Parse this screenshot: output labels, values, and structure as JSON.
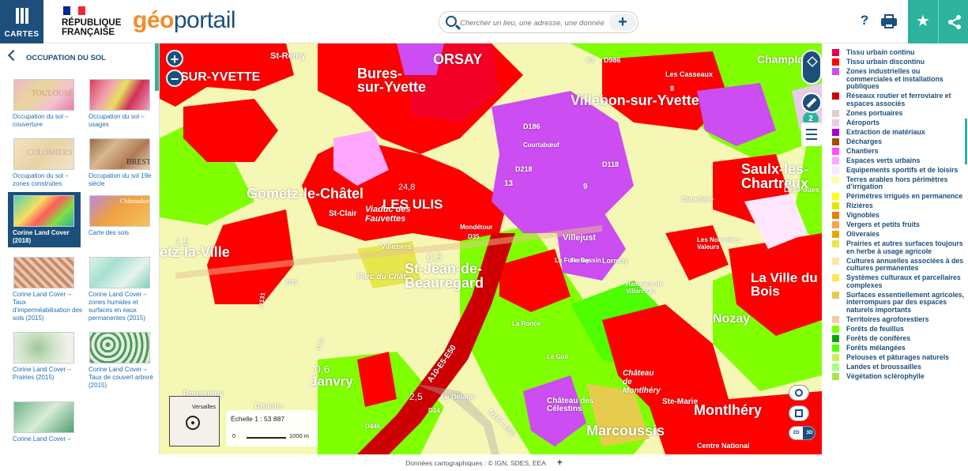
{
  "header": {
    "menu_label": "CARTES",
    "rf_text": "RÉPUBLIQUE\nFRANÇAISE",
    "logo_accent": "géo",
    "logo_rest": "portail",
    "search_placeholder": "Chercher un lieu, une adresse, une donnée",
    "search_plus": "+",
    "help_label": "?",
    "fav_icon": "★"
  },
  "sidebar": {
    "title": "OCCUPATION DU SOL",
    "thumbnails": [
      {
        "caption": "Occupation du sol – couverture",
        "img_text": "TOULOUSE"
      },
      {
        "caption": "Occupation du sol – usages",
        "img_text": ""
      },
      {
        "caption": "Occupation du sol – zones construites",
        "img_text": "COLOMIERS"
      },
      {
        "caption": "Occupation du sol 19e siècle",
        "img_text": "BREST"
      },
      {
        "caption": "Corine Land Cover (2018)",
        "img_text": ""
      },
      {
        "caption": "Carte des sols",
        "img_text": "Châteaulaou"
      },
      {
        "caption": "Corine Land Cover – Taux d’imperméabilisation des sols (2015)",
        "img_text": ""
      },
      {
        "caption": "Corine Land Cover – zones humides et surfaces en eaux permanentes (2015)",
        "img_text": ""
      },
      {
        "caption": "Corine Land Cover – Prairies (2015)",
        "img_text": ""
      },
      {
        "caption": "Corine Land Cover – Taux de couvert arboré (2015)",
        "img_text": ""
      },
      {
        "caption": "Corine Land Cover –",
        "img_text": ""
      }
    ],
    "selected_index": 4
  },
  "map": {
    "zoom_in": "+",
    "zoom_out": "−",
    "layers_count": "2",
    "btn_2d": "2D",
    "btn_3d": "3D",
    "overview_label": "Versailles",
    "scale_text": "Échelle 1 : 53 887",
    "scale_zero": "0",
    "scale_dist": "1000 m",
    "place_labels": [
      "St-Rémy",
      "Bures-sur-Yvette",
      "ORSAY",
      "Villebon-sur-Yvette",
      "Champlan",
      "Les Casseaux",
      "E-SUR-YVETTE",
      "Gometz-le-Châtel",
      "LES ULIS",
      "Saulx-les-Chartreux",
      "Mondétour",
      "St-Clair",
      "Viaduc des Fauvettes",
      "etz-la-Ville",
      "St-Jean-de-Beauregard",
      "Villejust",
      "Parc du Chât.",
      "Nozay",
      "La Ville du Bois",
      "Janvry",
      "Marcoussis",
      "Montlhéry",
      "Château de Montlhéry",
      "Ste-Marie",
      "Le Délage",
      "Roussigny",
      "Chante-",
      "Cimetière",
      "Les Nouvelles Valeurs",
      "Lormoy",
      "Fretay",
      "Hameaux de Villarceau",
      "A10-E5-E50",
      "N104-E50",
      "La Ronce",
      "Le Gué",
      "Château des Célestins",
      "Centre National",
      "Villeziers",
      "Courtabœuf",
      "La Folie Bessin",
      "Les Poues"
    ],
    "map_numbers": [
      "0,5",
      "1,5",
      "0,6",
      "2,5",
      "24,8",
      "13",
      "9",
      "63",
      "D986",
      "D218",
      "D186",
      "D118",
      "D35",
      "D35",
      "D40",
      "D131",
      "D24",
      "D446",
      "8"
    ]
  },
  "legend": {
    "items": [
      {
        "label": "Tissu urbain continu",
        "color": "#e6004d"
      },
      {
        "label": "Tissu urbain discontinu",
        "color": "#ff0000"
      },
      {
        "label": "Zones industrielles ou commerciales et installations publiques",
        "color": "#cc4df2"
      },
      {
        "label": "Réseaux routier et ferroviaire et espaces associés",
        "color": "#cc0000"
      },
      {
        "label": "Zones portuaires",
        "color": "#e6cccc"
      },
      {
        "label": "Aéroports",
        "color": "#e6cce6"
      },
      {
        "label": "Extraction de matériaux",
        "color": "#a600cc"
      },
      {
        "label": "Décharges",
        "color": "#a64d00"
      },
      {
        "label": "Chantiers",
        "color": "#ff4dff"
      },
      {
        "label": "Espaces verts urbains",
        "color": "#ffa6ff"
      },
      {
        "label": "Equipements sportifs et de loisirs",
        "color": "#ffe6ff"
      },
      {
        "label": "Terres arables hors périmètres d’irrigation",
        "color": "#ffffa8"
      },
      {
        "label": "Périmètres irrigués en permanence",
        "color": "#ffff00"
      },
      {
        "label": "Rizières",
        "color": "#e6e600"
      },
      {
        "label": "Vignobles",
        "color": "#e68000"
      },
      {
        "label": "Vergers et petits fruits",
        "color": "#f2a64d"
      },
      {
        "label": "Oliveraies",
        "color": "#e6a600"
      },
      {
        "label": "Prairies et autres surfaces toujours en herbe à usage agricole",
        "color": "#e6e64d"
      },
      {
        "label": "Cultures annuelles associées à des cultures permanentes",
        "color": "#ffe6a6"
      },
      {
        "label": "Systèmes culturaux et parcellaires complexes",
        "color": "#ffe64d"
      },
      {
        "label": "Surfaces essentiellement agricoles, interrompues par des espaces naturels importants",
        "color": "#e6cc4d"
      },
      {
        "label": "Territoires agroforestiers",
        "color": "#f2cca6"
      },
      {
        "label": "Forêts de feuillus",
        "color": "#80ff00"
      },
      {
        "label": "Forêts de conifères",
        "color": "#00a600"
      },
      {
        "label": "Forêts mélangées",
        "color": "#4dff00"
      },
      {
        "label": "Pelouses et pâturages naturels",
        "color": "#ccf24d"
      },
      {
        "label": "Landes et broussailles",
        "color": "#a6ff80"
      },
      {
        "label": "Végétation sclérophylle",
        "color": "#a6e64d"
      }
    ]
  },
  "footer": {
    "attribution": "Données cartographiques : ©   IGN,  SDES,  EEA",
    "plus": "+"
  }
}
